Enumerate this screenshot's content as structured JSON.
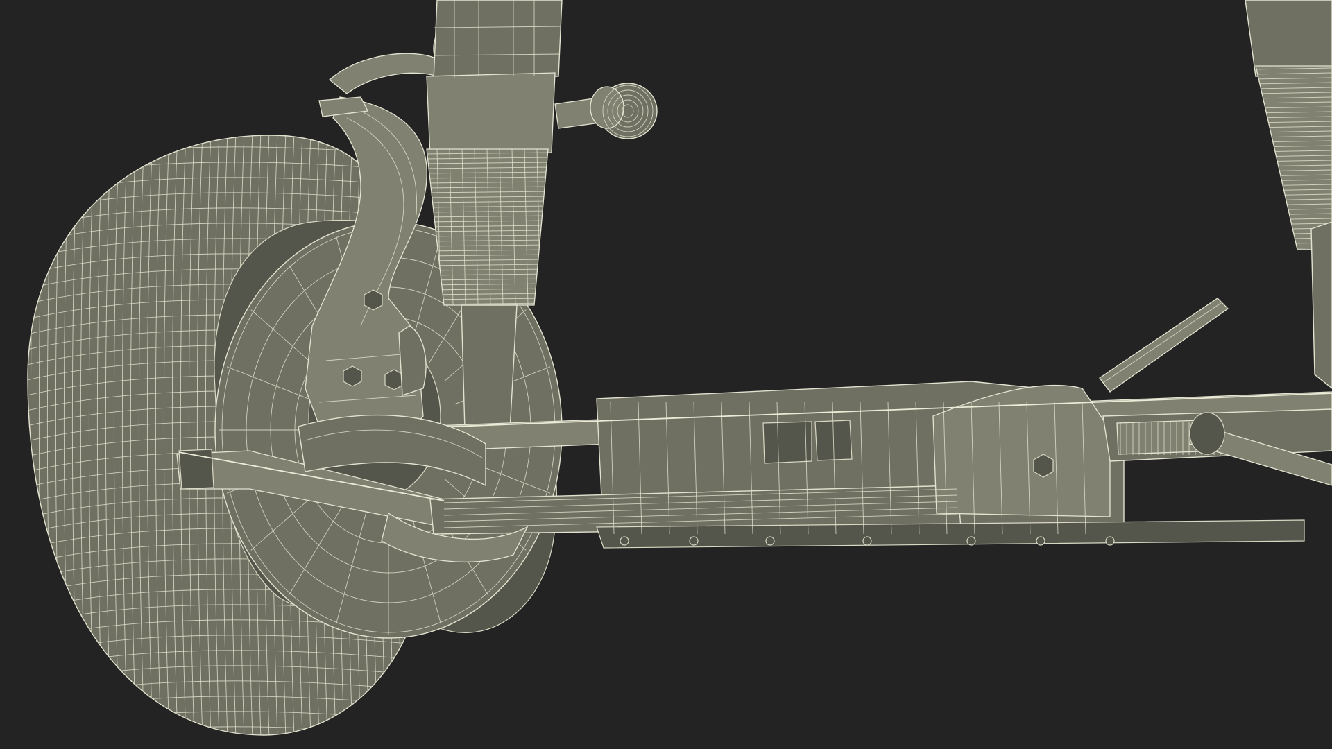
{
  "scene": {
    "colors": {
      "background": "#232323",
      "surface": "#6f7062",
      "surface_light": "#808171",
      "surface_dark": "#55564b",
      "wireframe": "#e2e2cf"
    }
  }
}
